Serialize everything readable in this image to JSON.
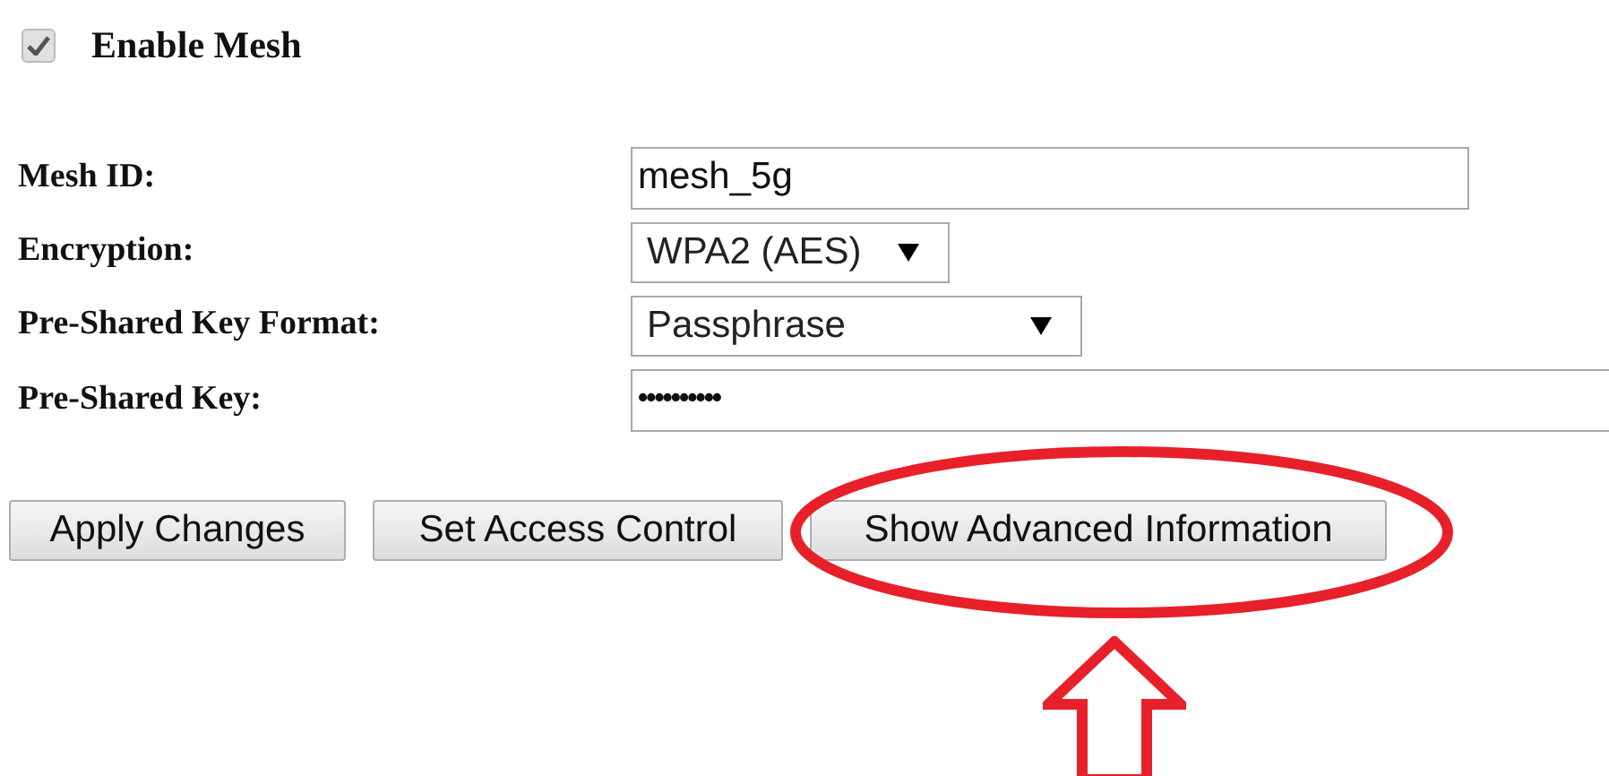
{
  "enable_mesh": {
    "label": "Enable Mesh",
    "checked": true
  },
  "fields": [
    {
      "label": "Mesh ID:",
      "kind": "text",
      "value": "mesh_5g"
    },
    {
      "label": "Encryption:",
      "kind": "select",
      "value": "WPA2 (AES)"
    },
    {
      "label": "Pre-Shared Key Format:",
      "kind": "select",
      "value": "Passphrase"
    },
    {
      "label": "Pre-Shared Key:",
      "kind": "password",
      "value": "••••••••••"
    }
  ],
  "buttons": [
    "Apply Changes",
    "Set Access Control",
    "Show Advanced Information"
  ]
}
